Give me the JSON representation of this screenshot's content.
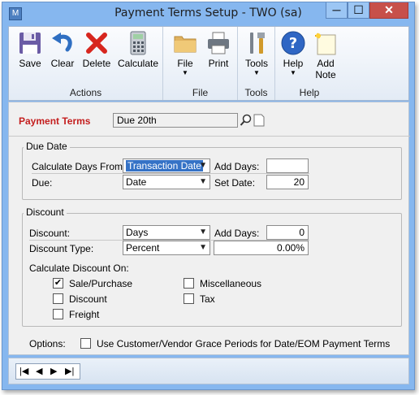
{
  "window": {
    "title": "Payment Terms Setup  -  TWO (sa)",
    "controls": {
      "minimize": "─",
      "maximize": "☐",
      "close": "✕"
    }
  },
  "ribbon": {
    "actions": {
      "label": "Actions",
      "buttons": [
        "Save",
        "Clear",
        "Delete",
        "Calculate"
      ]
    },
    "file": {
      "label": "File",
      "buttons": [
        "File",
        "Print"
      ]
    },
    "tools": {
      "label": "Tools",
      "buttons": [
        "Tools"
      ]
    },
    "help": {
      "label": "Help",
      "buttons": [
        "Help",
        "Add",
        "Note"
      ]
    },
    "dropdown_glyph": "▼"
  },
  "form": {
    "payment_terms": {
      "label": "Payment Terms",
      "value": "Due 20th"
    },
    "due_date": {
      "title": "Due Date",
      "calc_from_label": "Calculate Days From:",
      "calc_from_value": "Transaction Date",
      "add_days_label": "Add Days:",
      "add_days_value": "",
      "due_label": "Due:",
      "due_value": "Date",
      "set_date_label": "Set Date:",
      "set_date_value": "20"
    },
    "discount": {
      "title": "Discount",
      "discount_label": "Discount:",
      "discount_value": "Days",
      "add_days_label": "Add Days:",
      "add_days_value": "0",
      "type_label": "Discount Type:",
      "type_value": "Percent",
      "amount_value": "0.00%",
      "calc_on_label": "Calculate Discount On:",
      "checks": {
        "sale_purchase": {
          "label": "Sale/Purchase",
          "checked": "✔"
        },
        "discount": {
          "label": "Discount",
          "checked": ""
        },
        "freight": {
          "label": "Freight",
          "checked": ""
        },
        "miscellaneous": {
          "label": "Miscellaneous",
          "checked": ""
        },
        "tax": {
          "label": "Tax",
          "checked": ""
        }
      }
    },
    "options": {
      "label": "Options:",
      "grace_label": "Use Customer/Vendor Grace Periods for Date/EOM Payment Terms",
      "grace_checked": ""
    }
  },
  "statusbar": {
    "nav_first": "|◀",
    "nav_prev": "◀",
    "nav_next": "▶",
    "nav_last": "▶|"
  },
  "icons": {
    "app": "app-icon",
    "save": "floppy-disk-icon",
    "clear": "undo-arrow-icon",
    "delete": "red-x-icon",
    "calculate": "calculator-icon",
    "file": "folder-icon",
    "print": "printer-icon",
    "tools": "tools-icon",
    "help": "help-icon",
    "add_note": "note-icon"
  }
}
